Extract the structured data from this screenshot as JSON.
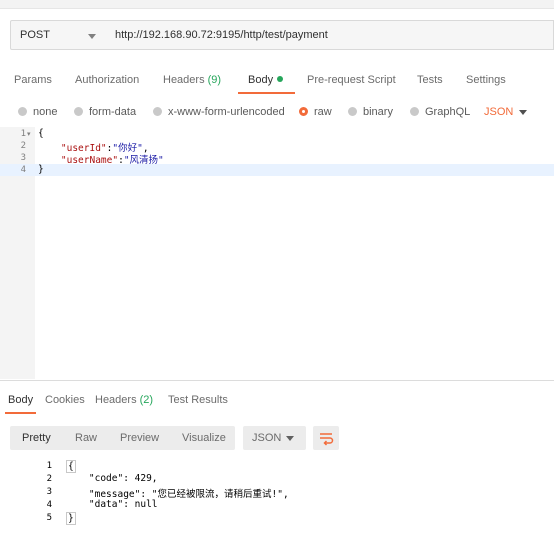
{
  "request": {
    "method": "POST",
    "url": "http://192.168.90.72:9195/http/test/payment"
  },
  "request_tabs": [
    {
      "label": "Params"
    },
    {
      "label": "Authorization"
    },
    {
      "label": "Headers",
      "count": "(9)"
    },
    {
      "label": "Body"
    },
    {
      "label": "Pre-request Script"
    },
    {
      "label": "Tests"
    },
    {
      "label": "Settings"
    }
  ],
  "active_request_tab": "Body",
  "body_types": [
    "none",
    "form-data",
    "x-www-form-urlencoded",
    "raw",
    "binary",
    "GraphQL"
  ],
  "selected_body_type": "raw",
  "raw_format": "JSON",
  "editor": {
    "line_numbers": [
      "1",
      "2",
      "3",
      "4"
    ],
    "lines": [
      {
        "text": "{"
      },
      {
        "indent": "    ",
        "key": "\"userId\"",
        "sep": ":",
        "value": "\"你好\"",
        "tail": ","
      },
      {
        "indent": "    ",
        "key": "\"userName\"",
        "sep": ":",
        "value": "\"风清扬\"",
        "tail": ""
      },
      {
        "text": "}"
      }
    ]
  },
  "response_tabs": [
    {
      "label": "Body"
    },
    {
      "label": "Cookies"
    },
    {
      "label": "Headers",
      "count": "(2)"
    },
    {
      "label": "Test Results"
    }
  ],
  "active_response_tab": "Body",
  "view_modes": [
    "Pretty",
    "Raw",
    "Preview",
    "Visualize"
  ],
  "active_view_mode": "Pretty",
  "response_format": "JSON",
  "response": {
    "line_numbers": [
      "1",
      "2",
      "3",
      "4",
      "5"
    ],
    "lines": [
      {
        "text": "{"
      },
      {
        "text": "    \"code\": 429,"
      },
      {
        "text": "    \"message\": \"您已经被限流，请稍后重试!\","
      },
      {
        "text": "    \"data\": null"
      },
      {
        "text": "}"
      }
    ]
  },
  "colors": {
    "accent": "#f26b3a",
    "count_green": "#26a65b"
  },
  "icons": [
    "chevron-down-icon",
    "wrap-lines-icon",
    "fold-arrow-icon"
  ]
}
